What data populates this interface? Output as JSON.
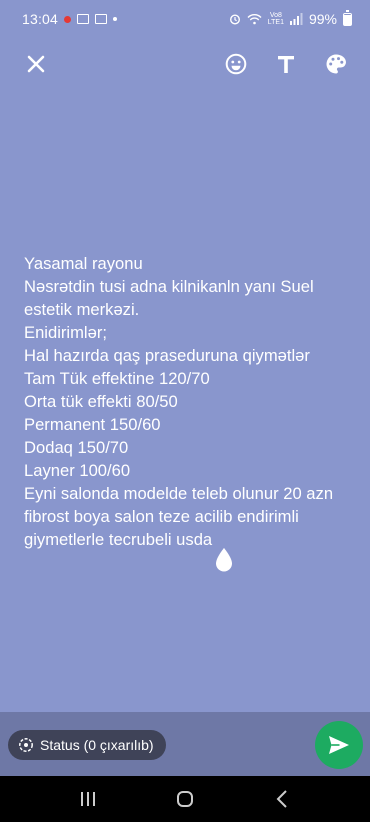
{
  "status_bar": {
    "time": "13:04",
    "network_top": "Vo8",
    "network_bottom": "LTE1",
    "battery": "99%"
  },
  "toolbar": {
    "icons": [
      "close-icon",
      "emoji-icon",
      "text-icon",
      "palette-icon"
    ]
  },
  "status_text": {
    "lines": [
      "Yasamal rayonu",
      "Nəsrətdin tusi adna kilnikanln yanı Suel estetik merkəzi.",
      "Enidirimlər;",
      "Hal hazırda qaş praseduruna qiymətlər",
      "Tam Tük effektine 120/70",
      "Orta tük effekti 80/50",
      "Permanent 150/60",
      "Dodaq 150/70",
      "Layner 100/60",
      "Eyni salonda modelde teleb olunur 20 azn fibrost boya salon teze acilib endirimli giymetlerle tecrubeli usda"
    ]
  },
  "bottom": {
    "status_chip_label": "Status (0 çıxarılıb)"
  },
  "colors": {
    "background": "#8996cd",
    "send_button": "#1dab61",
    "chip": "#3f4358"
  }
}
